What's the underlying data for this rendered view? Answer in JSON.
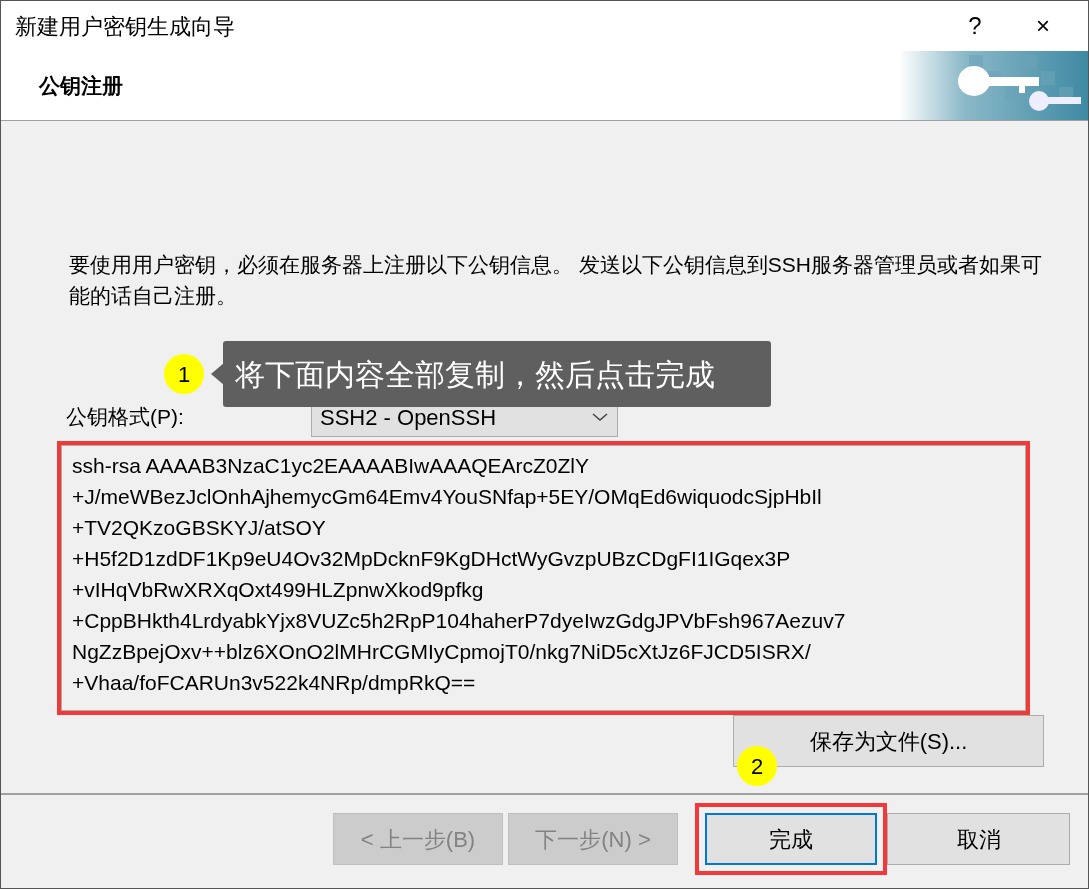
{
  "window": {
    "title": "新建用户密钥生成向导",
    "help": "?",
    "close": "×"
  },
  "header": {
    "title": "公钥注册",
    "kind": "picture"
  },
  "description": "要使用用户密钥，必须在服务器上注册以下公钥信息。 发送以下公钥信息到SSH服务器管理员或者如果可能的话自己注册。",
  "format": {
    "label": "公钥格式(P):",
    "value": "SSH2 - OpenSSH"
  },
  "public_key": {
    "highlight": true,
    "lines": [
      "ssh-rsa AAAAB3NzaC1yc2EAAAABIwAAAQEArcZ0ZlY",
      "+J/meWBezJclOnhAjhemycGm64Emv4YouSNfap+5EY/OMqEd6wiquodcSjpHbIl",
      "+TV2QKzoGBSKYJ/atSOY",
      "+H5f2D1zdDF1Kp9eU4Ov32MpDcknF9KgDHctWyGvzpUBzCDgFI1IGqex3P",
      "+vIHqVbRwXRXqOxt499HLZpnwXkod9pfkg",
      "+CppBHkth4LrdyabkYjx8VUZc5h2RpP104haherP7dyeIwzGdgJPVbFsh967Aezuv7",
      "NgZzBpejOxv++blz6XOnO2lMHrCGMIyCpmojT0/nkg7NiD5cXtJz6FJCD5ISRX/",
      "+Vhaa/foFCARUn3v522k4NRp/dmpRkQ=="
    ]
  },
  "save_button": {
    "label": "保存为文件(S)..."
  },
  "buttons": [
    {
      "kind": "back",
      "label": "< 上一步(B)",
      "disabled": true,
      "highlight": false
    },
    {
      "kind": "next",
      "label": "下一步(N) >",
      "disabled": true,
      "highlight": false
    },
    {
      "kind": "finish",
      "label": "完成",
      "disabled": false,
      "highlight": true
    },
    {
      "kind": "cancel",
      "label": "取消",
      "disabled": false,
      "highlight": false
    }
  ],
  "annotations": [
    {
      "kind": "step",
      "number": "1",
      "text": "将下面内容全部复制，然后点击完成"
    },
    {
      "kind": "step",
      "number": "2"
    }
  ]
}
